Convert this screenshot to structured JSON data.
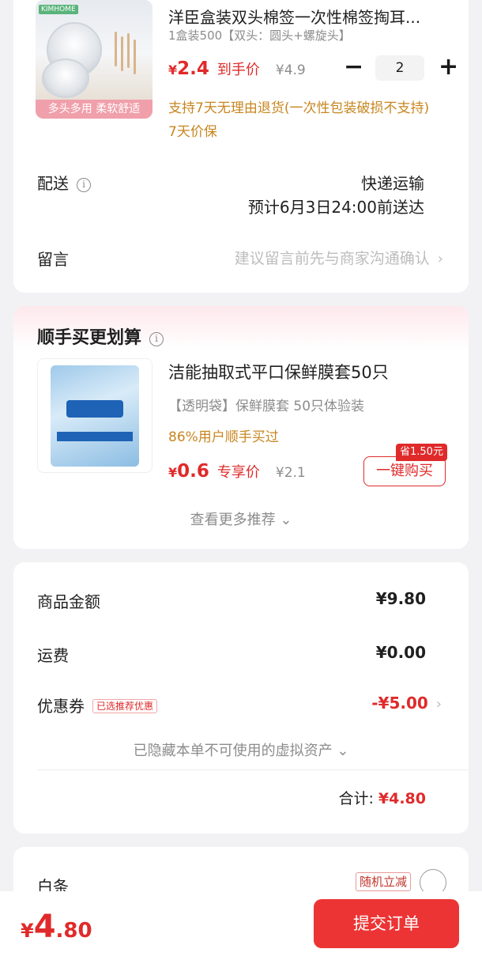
{
  "product": {
    "title": "洋臣盒装双头棉签一次性棉签掏耳...",
    "spec": "1盒装500【双头：圆头+螺旋头】",
    "thumb_brand": "KIMHOME",
    "thumb_banner": "多头多用 柔软舒适",
    "currency": "¥",
    "price": "2.4",
    "price_label": "到手价",
    "original_price": "¥4.9",
    "quantity": "2",
    "minus": "−",
    "plus": "+",
    "return_note": "支持7天无理由退货(一次性包装破损不支持)",
    "price_protect": "7天价保"
  },
  "delivery": {
    "label": "配送",
    "info_icon": "i",
    "method": "快递运输",
    "eta": "预计6月3日24:00前送达"
  },
  "message": {
    "label": "留言",
    "placeholder": "建议留言前先与商家沟通确认",
    "chevron": "›"
  },
  "recommend": {
    "section_title": "顺手买更划算",
    "info_icon": "i",
    "title": "洁能抽取式平口保鲜膜套50只",
    "spec": "【透明袋】保鲜膜套 50只体验装",
    "social": "86%用户顺手买过",
    "currency": "¥",
    "price": "0.6",
    "price_label": "专享价",
    "original_price": "¥2.1",
    "save_tag": "省1.50元",
    "buy_button": "一键购买",
    "more": "查看更多推荐 ⌄"
  },
  "totals": {
    "goods_label": "商品金额",
    "goods_value": "¥9.80",
    "shipping_label": "运费",
    "shipping_value": "¥0.00",
    "coupon_label": "优惠券",
    "coupon_badge": "已选推荐优惠",
    "coupon_value": "-¥5.00",
    "chevron": "›",
    "hidden_assets": "已隐藏本单不可使用的虚拟资产 ⌄",
    "sum_label": "合计:",
    "sum_value": "¥4.80"
  },
  "payment": {
    "label": "白条",
    "promo": "随机立减"
  },
  "bottom": {
    "currency": "¥",
    "total_int": "4",
    "total_dec": ".80",
    "submit": "提交订单"
  },
  "colors": {
    "accent_red": "#e02a2a",
    "submit_red": "#ec3434",
    "note_orange": "#c7861f",
    "muted_grey": "#8c8c8c",
    "page_bg": "#f2f2f4"
  }
}
